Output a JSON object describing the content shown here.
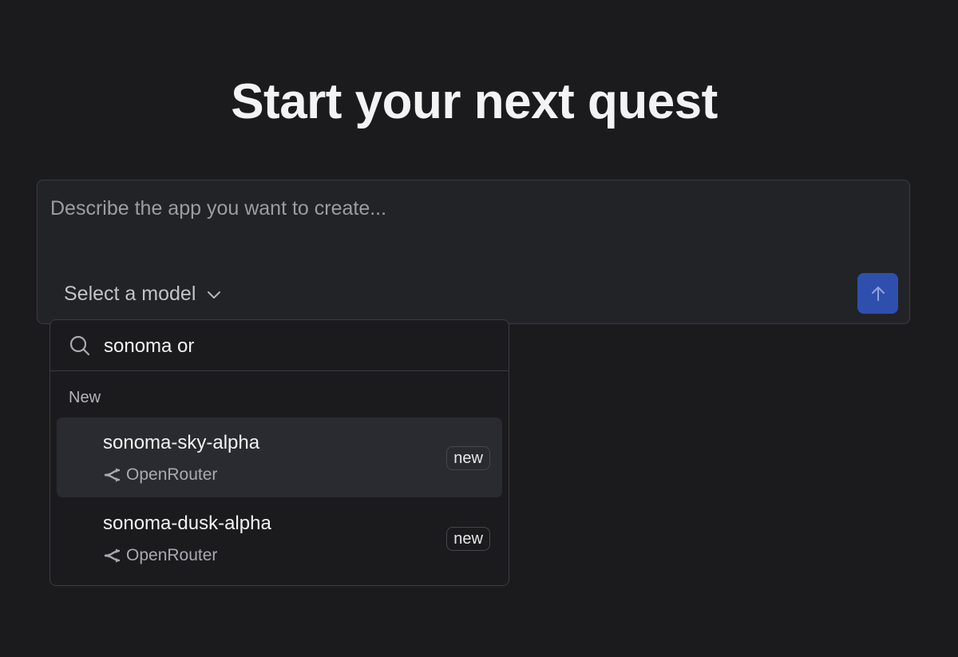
{
  "page": {
    "title": "Start your next quest"
  },
  "composer": {
    "placeholder": "Describe the app you want to create...",
    "value": "",
    "model_select_label": "Select a model",
    "chevron_icon": "chevron-down-icon",
    "send_icon": "arrow-up-icon",
    "send_color": "#2f4fae"
  },
  "model_dropdown": {
    "search_value": "sonoma or",
    "search_icon": "search-icon",
    "group_label": "New",
    "options": [
      {
        "name": "sonoma-sky-alpha",
        "provider": "OpenRouter",
        "provider_icon": "openrouter-icon",
        "badge": "new",
        "highlighted": true
      },
      {
        "name": "sonoma-dusk-alpha",
        "provider": "OpenRouter",
        "provider_icon": "openrouter-icon",
        "badge": "new",
        "highlighted": false
      }
    ]
  }
}
